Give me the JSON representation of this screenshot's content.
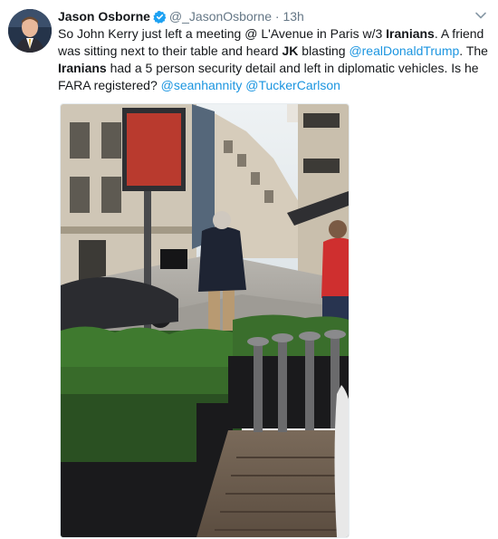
{
  "tweet": {
    "author_name": "Jason Osborne",
    "author_handle": "@_JasonOsborne",
    "separator": "·",
    "timestamp": "13h",
    "body": {
      "p1": "So John Kerry just left a meeting @ L'Avenue in Paris w/3 ",
      "iranians1": "Iranians",
      "p2": ". A friend was sitting next to their table and heard ",
      "jk": "JK",
      "p3": " blasting ",
      "mention_trump": "@realDonaldTrump",
      "p4": ". The ",
      "iranians2": "Iranians",
      "p5": " had a 5 person security detail and left in diplomatic vehicles. Is he FARA registered? ",
      "mention_hannity": "@seanhannity",
      "p6": " ",
      "mention_carlson": "@TuckerCarlson"
    },
    "colors": {
      "link": "#1b95e0",
      "verified": "#1da1f2",
      "secondary_text": "#657786"
    },
    "icons": {
      "verified": "verified-badge-icon",
      "menu": "chevron-down-icon"
    }
  }
}
